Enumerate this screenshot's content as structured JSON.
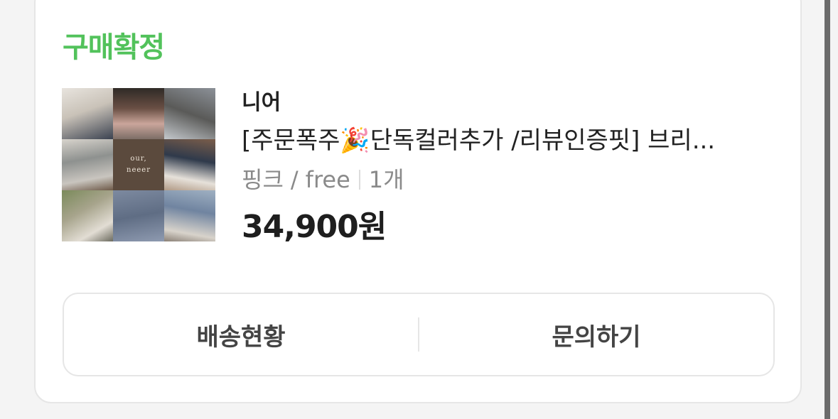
{
  "order": {
    "status": "구매확정",
    "thumbnail_logo": [
      "our,",
      "neeer"
    ],
    "brand": "니어",
    "product_name": "[주문폭주🎉단독컬러추가 /리뷰인증핏] 브리...",
    "option_color": "핑크",
    "option_separator": "/",
    "option_size": "free",
    "quantity": "1개",
    "price": "34,900원"
  },
  "actions": {
    "shipping_label": "배송현황",
    "inquiry_label": "문의하기"
  },
  "colors": {
    "status": "#52c25b",
    "text": "#222222",
    "muted": "#8a8a8a"
  }
}
